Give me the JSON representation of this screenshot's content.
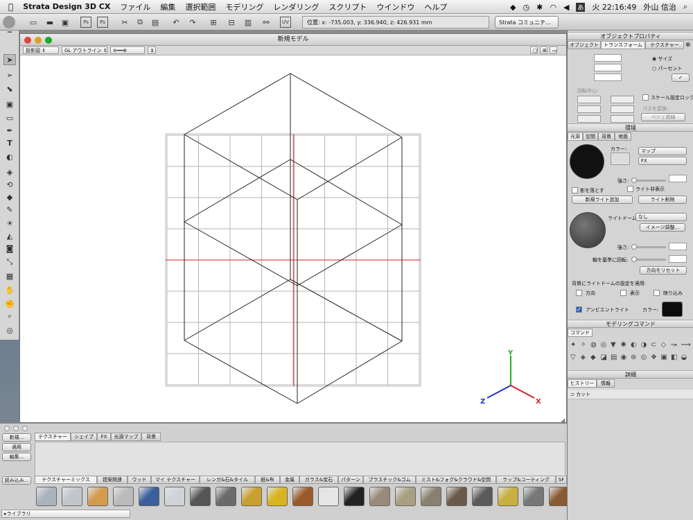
{
  "menubar": {
    "app_name": "Strata Design 3D CX",
    "items": [
      "ファイル",
      "編集",
      "選択範囲",
      "モデリング",
      "レンダリング",
      "スクリプト",
      "ウインドウ",
      "ヘルプ"
    ],
    "input_indicator": "あ",
    "clock": "火 22:16:49",
    "user": "外山 信治"
  },
  "toolbar": {
    "coord_readout": "位置: x: -735.003, y: 336.940, z: 426.931 mm",
    "community_select": "Strata コミュニテ..."
  },
  "document": {
    "title": "新規モデル",
    "view_select": "投影図",
    "render_select": "GL アウトライン"
  },
  "axes": {
    "x": "X",
    "y": "Y",
    "z": "Z"
  },
  "bottom": {
    "buttons": {
      "new": "新規...",
      "apply": "適用",
      "edit": "編集...",
      "load": "読み込み..."
    },
    "top_tabs": [
      "テクスチャー",
      "シェイプ",
      "FX",
      "光源マップ",
      "背景"
    ],
    "categories": [
      "テクスチャーミックス",
      "建築関連",
      "ウッド",
      "マイ テクスチャー",
      "レンガ&石&タイル",
      "紙&布",
      "金属",
      "ガラス&宝石",
      "パターン",
      "プラスチック&ゴム",
      "ミスト&フォグ&クラウド&空間",
      "ラップ&コーティング",
      "SF"
    ],
    "library_select": "ライブラリ"
  },
  "colors": {
    "axis_x": "#d62020",
    "axis_y": "#20b020",
    "axis_z": "#2030d0"
  },
  "swatches": [
    {
      "icon": "chrome-swatch",
      "color": "#a9b3bd"
    },
    {
      "icon": "chrome2-swatch",
      "color": "#c0c6cc"
    },
    {
      "icon": "wood-swatch",
      "color": "#d49a4e"
    },
    {
      "icon": "checker-swatch",
      "color": "#bbbbbb"
    },
    {
      "icon": "sky-swatch",
      "color": "#3a5f9a"
    },
    {
      "icon": "silver-swatch",
      "color": "#d0d4d8"
    },
    {
      "icon": "carbon-swatch",
      "color": "#555555"
    },
    {
      "icon": "steel-swatch",
      "color": "#6a6a6a"
    },
    {
      "icon": "brass-swatch",
      "color": "#c9a030"
    },
    {
      "icon": "gold-swatch",
      "color": "#d9b420"
    },
    {
      "icon": "cork-swatch",
      "color": "#9a5a2a"
    },
    {
      "icon": "white-swatch",
      "color": "#e6e6e6"
    },
    {
      "icon": "bw-checker-swatch",
      "color": "#222222"
    },
    {
      "icon": "tile-swatch",
      "color": "#9a8a7a"
    },
    {
      "icon": "marble-swatch",
      "color": "#a8a080"
    },
    {
      "icon": "stone-swatch",
      "color": "#8a8070"
    },
    {
      "icon": "cobble-swatch",
      "color": "#6a5a4a"
    },
    {
      "icon": "diamond-plate-swatch",
      "color": "#5a5a5a"
    },
    {
      "icon": "gold2-swatch",
      "color": "#c8b040"
    },
    {
      "icon": "treadplate-swatch",
      "color": "#777777"
    },
    {
      "icon": "leather-swatch",
      "color": "#8a5a30"
    },
    {
      "icon": "mosaic-swatch",
      "color": "#7a6a6a"
    }
  ],
  "rp": {
    "obj_title": "オブジェクトプロパティ",
    "obj_tabs": [
      "オブジェクト",
      "トランスフォーム",
      "テクスチャー"
    ],
    "size_radio": "サイズ",
    "percent_radio": "パーセント",
    "rot_center": "回転中心:",
    "scale_lock": "スケール設定ロック",
    "path_convert": "パスを変換:",
    "bezier_select": "ベジェ曲線",
    "env_title": "環境",
    "env_tabs": [
      "光源",
      "空間",
      "背景",
      "地面"
    ],
    "color_label": "カラー:",
    "map_select": "マップ",
    "fx_select": "FX",
    "strength_label": "強さ:",
    "cast_shadow": "影を落とす",
    "hide_light": "ライト非表示",
    "add_light": "新規ライト追加",
    "delete_light": "ライト削除",
    "lightdome_label": "ライトドーム:",
    "lightdome_select": "なし",
    "image_adjust": "イメージ調整...",
    "rotate_axis": "軸を基準に回転:",
    "reset_dir": "方向をリセット",
    "apply_bg": "背景にライトドームの設定を適用:",
    "opt_dir": "方向",
    "opt_show": "表示",
    "opt_reflect": "映り込み",
    "ambient": "アンビエントライト",
    "modeling_title": "モデリングコマンド",
    "command_tab": "コマンド",
    "detail_title": "詳細",
    "detail_tabs": [
      "ヒストリー",
      "情報"
    ],
    "history_item": "カット"
  }
}
